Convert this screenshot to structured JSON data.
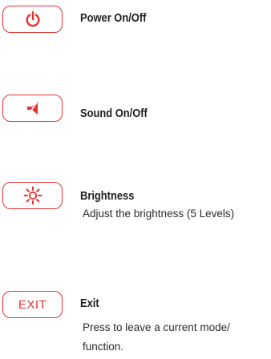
{
  "accent_color": "#e8312f",
  "items": [
    {
      "icon": "power-icon",
      "title": "Power On/Off",
      "description_lines": []
    },
    {
      "icon": "speaker-icon",
      "title": "Sound On/Off",
      "description_lines": []
    },
    {
      "icon": "brightness-icon",
      "title": "Brightness",
      "description_lines": [
        "Adjust the brightness (5 Levels)"
      ]
    },
    {
      "button_label": "EXIT",
      "title": "Exit",
      "description_lines": [
        "Press to leave a current mode/",
        "function."
      ]
    }
  ]
}
